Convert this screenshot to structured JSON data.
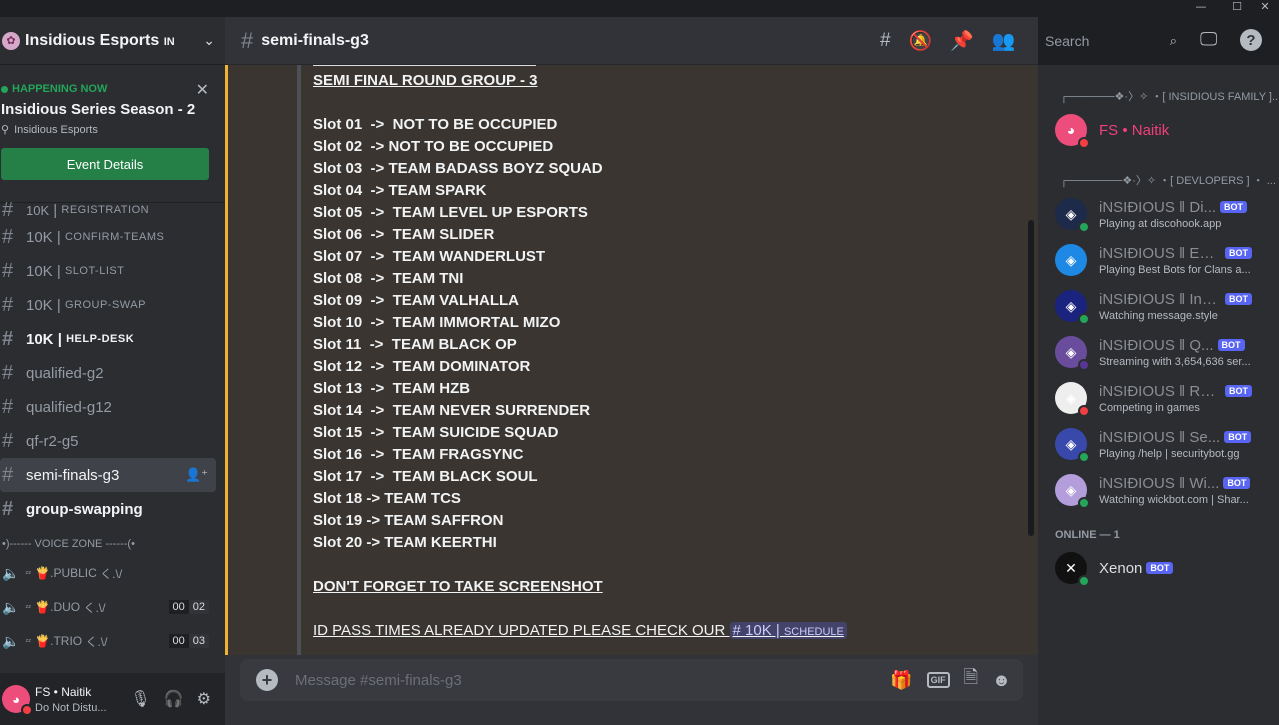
{
  "window": {
    "minimize": "—",
    "maximize": "☐",
    "close": "✕"
  },
  "server": {
    "name": "Insidious Esports",
    "badge": "IN"
  },
  "event": {
    "status": "HAPPENING NOW",
    "title": "Insidious Series Season - 2",
    "host": "Insidious Esports",
    "button": "Event Details"
  },
  "channels": [
    {
      "prefix": "10K",
      "name": "REGISTRATION",
      "type": "partial"
    },
    {
      "prefix": "10K",
      "name": "CONFIRM-TEAMS",
      "type": "sc"
    },
    {
      "prefix": "10K",
      "name": "SLOT-LIST",
      "type": "sc"
    },
    {
      "prefix": "10K",
      "name": "GROUP-SWAP",
      "type": "sc"
    },
    {
      "prefix": "10K",
      "name": "HELP-DESK",
      "type": "sc-unread"
    },
    {
      "name": "qualified-g2"
    },
    {
      "name": "qualified-g12"
    },
    {
      "name": "qf-r2-g5"
    },
    {
      "name": "semi-finals-g3",
      "active": true
    },
    {
      "name": "group-swapping",
      "unread": true
    }
  ],
  "voice_category": "•)------ VOICE ZONE ------(•",
  "voice": [
    {
      "name": ".PUBLIC",
      "tail": "く.\\/"
    },
    {
      "name": ".DUO",
      "tail": "く.\\/",
      "count_a": "00",
      "count_b": "02"
    },
    {
      "name": ".TRIO",
      "tail": "く.\\/",
      "count_a": "00",
      "count_b": "03"
    }
  ],
  "user": {
    "name": "FS • Naitik",
    "status": "Do Not Distu..."
  },
  "channel_header": {
    "name": "semi-finals-g3"
  },
  "search": {
    "placeholder": "Search"
  },
  "message": {
    "heading": "SEMI FINAL ROUND GROUP - 3",
    "slots": [
      "Slot 01  ->  NOT TO BE OCCUPIED",
      "Slot 02  -> NOT TO BE OCCUPIED",
      "Slot 03  -> TEAM BADASS BOYZ SQUAD",
      "Slot 04  -> TEAM SPARK",
      "Slot 05  ->  TEAM LEVEL UP ESPORTS",
      "Slot 06  ->  TEAM SLIDER",
      "Slot 07  ->  TEAM WANDERLUST",
      "Slot 08  ->  TEAM TNI",
      "Slot 09  ->  TEAM VALHALLA",
      "Slot 10  ->  TEAM IMMORTAL MIZO",
      "Slot 11  ->  TEAM BLACK OP",
      "Slot 12  ->  TEAM DOMINATOR",
      "Slot 13  ->  TEAM HZB",
      "Slot 14  ->  TEAM NEVER SURRENDER",
      "Slot 15  ->  TEAM SUICIDE SQUAD",
      "Slot 16  ->  TEAM FRAGSYNC",
      "Slot 17  ->  TEAM BLACK SOUL",
      "Slot 18 -> TEAM TCS",
      "Slot 19 -> TEAM SAFFRON",
      "Slot 20 -> TEAM KEERTHI"
    ],
    "reminder": "DON'T FORGET TO TAKE SCREENSHOT",
    "idpass": "ID PASS TIMES ALREADY UPDATED PLEASE CHECK OUR ",
    "mention_prefix": "10K",
    "mention_name": "SCHEDULE"
  },
  "composer": {
    "placeholder": "Message #semi-finals-g3",
    "gif": "GIF"
  },
  "members": {
    "cat1": "┌──────❖·〉✧ ・[ INSIDIOUS FAMILY ]...",
    "cat2": "┌───────❖·〉✧ ・[ DEVLOPERS ] ・ ...",
    "cat3": "ONLINE — 1",
    "family": [
      {
        "name": "FS • Naitik",
        "color": "#f23f7a"
      }
    ],
    "devs": [
      {
        "name": "iNSIĐIOUS ‖ Di...",
        "activity": "Playing at discohook.app",
        "bg": "#1e2a4a",
        "status": "on"
      },
      {
        "name": "iNSIĐIOUS ‖ ESP...",
        "activity": "Playing Best Bots for Clans a...",
        "bg": "#1e88e5",
        "status": "none"
      },
      {
        "name": "iNSIĐIOUS ‖ Ins...",
        "activity": "Watching message.style",
        "bg": "#1a237e",
        "status": "on"
      },
      {
        "name": "iNSIĐIOUS ‖ Q...",
        "activity": "Streaming with 3,654,636 ser...",
        "bg": "#6a4c9c",
        "status": "str"
      },
      {
        "name": "iNSIĐIOUS ‖ RE...",
        "activity": "Competing in games",
        "bg": "#eeeeee",
        "status": "dndc"
      },
      {
        "name": "iNSIĐIOUS ‖ Se...",
        "activity": "Playing /help | securitybot.gg",
        "bg": "#3949ab",
        "status": "on"
      },
      {
        "name": "iNSIĐIOUS ‖ Wi...",
        "activity": "Watching wickbot.com | Shar...",
        "bg": "#b39ddb",
        "status": "on"
      }
    ],
    "online": [
      {
        "name": "Xenon",
        "bg": "#111111",
        "status": "on"
      }
    ],
    "bot_label": "BOT"
  }
}
